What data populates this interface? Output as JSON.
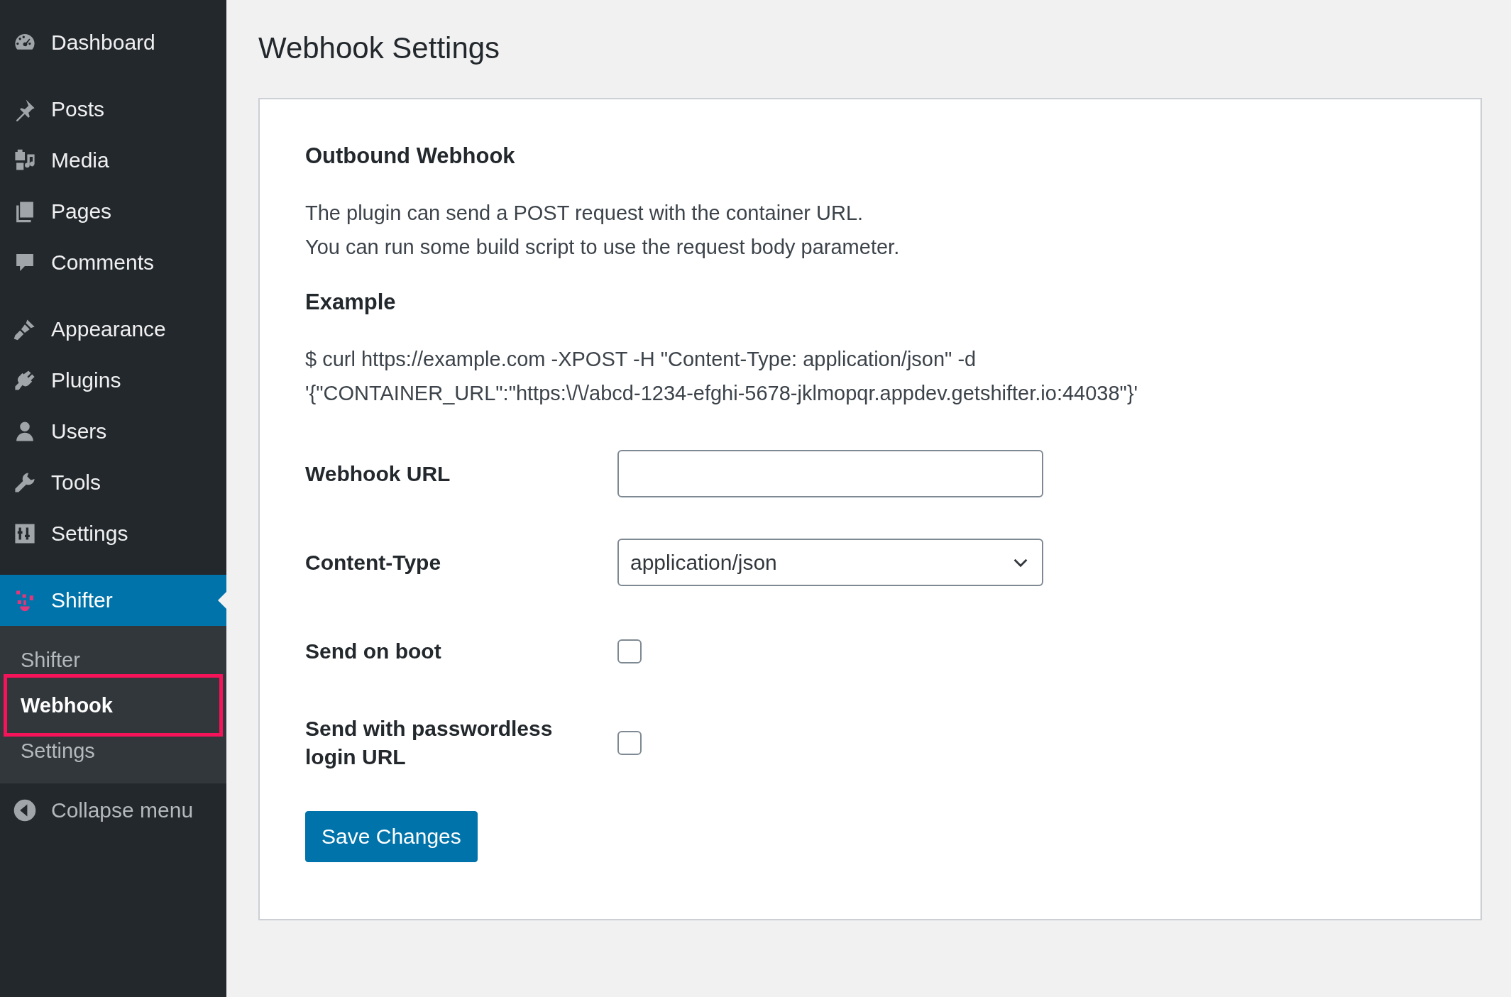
{
  "sidebar": {
    "groups": [
      {
        "items": [
          {
            "label": "Dashboard"
          }
        ]
      },
      {
        "items": [
          {
            "label": "Posts"
          },
          {
            "label": "Media"
          },
          {
            "label": "Pages"
          },
          {
            "label": "Comments"
          }
        ]
      },
      {
        "items": [
          {
            "label": "Appearance"
          },
          {
            "label": "Plugins"
          },
          {
            "label": "Users"
          },
          {
            "label": "Tools"
          },
          {
            "label": "Settings"
          }
        ]
      }
    ],
    "current": {
      "label": "Shifter",
      "submenu": [
        {
          "label": "Shifter",
          "selected": false,
          "highlighted": false
        },
        {
          "label": "Webhook",
          "selected": true,
          "highlighted": true
        },
        {
          "label": "Settings",
          "selected": false,
          "highlighted": false
        }
      ]
    },
    "collapse": "Collapse menu"
  },
  "page": {
    "title": "Webhook Settings",
    "section": {
      "heading": "Outbound Webhook",
      "lines": [
        "The plugin can send a POST request with the container URL.",
        "You can run some build script to use the request body parameter."
      ]
    },
    "example": {
      "heading": "Example",
      "lines": [
        "$ curl https://example.com -XPOST -H \"Content-Type: application/json\" -d",
        "'{\"CONTAINER_URL\":\"https:\\/\\/abcd-1234-efghi-5678-jklmopqr.appdev.getshifter.io:44038\"}'"
      ]
    },
    "fields": [
      {
        "kind": "text",
        "label": "Webhook URL"
      },
      {
        "kind": "select",
        "label": "Content-Type",
        "value": "application/json"
      },
      {
        "kind": "checkbox",
        "label": "Send on boot",
        "checked": false
      },
      {
        "kind": "checkbox",
        "label": "Send with passwordless login URL",
        "checked": false
      }
    ],
    "save_button": "Save Changes"
  }
}
